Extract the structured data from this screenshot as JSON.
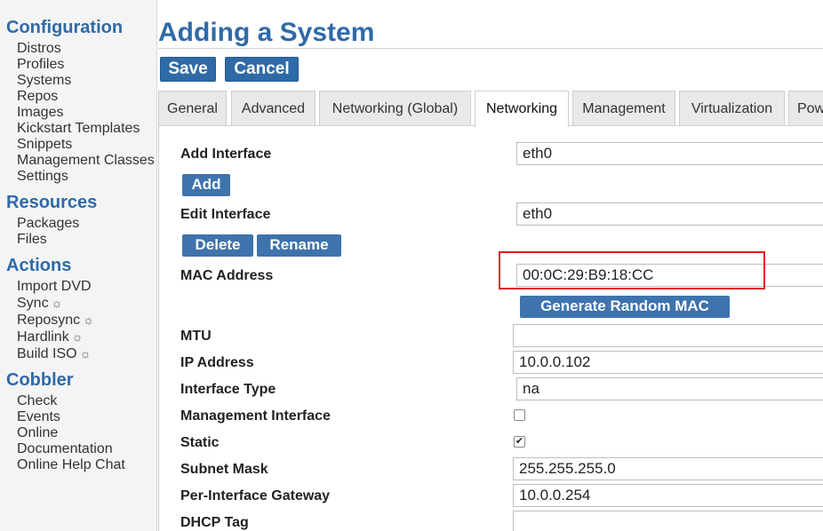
{
  "sidebar": {
    "sections": [
      {
        "heading": "Configuration",
        "items": [
          "Distros",
          "Profiles",
          "Systems",
          "Repos",
          "Images",
          "Kickstart Templates",
          "Snippets",
          "Management Classes",
          "Settings"
        ]
      },
      {
        "heading": "Resources",
        "items": [
          "Packages",
          "Files"
        ]
      },
      {
        "heading": "Actions",
        "items": [
          "Import DVD",
          "Sync",
          "Reposync",
          "Hardlink",
          "Build ISO"
        ]
      },
      {
        "heading": "Cobbler",
        "items": [
          "Check",
          "Events",
          "Online Documentation",
          "Online Help Chat"
        ]
      }
    ],
    "gear_glyph": "☼"
  },
  "header": {
    "title": "Adding a System"
  },
  "toolbar": {
    "save_label": "Save",
    "cancel_label": "Cancel"
  },
  "tabs": [
    "General",
    "Advanced",
    "Networking (Global)",
    "Networking",
    "Management",
    "Virtualization",
    "Pow"
  ],
  "active_tab": "Networking",
  "form": {
    "add_interface": {
      "label": "Add Interface",
      "value": "eth0",
      "button": "Add"
    },
    "edit_interface": {
      "label": "Edit Interface",
      "value": "eth0",
      "delete_button": "Delete",
      "rename_button": "Rename"
    },
    "mac_address": {
      "label": "MAC Address",
      "value": "00:0C:29:B9:18:CC",
      "generate_button": "Generate Random MAC"
    },
    "mtu": {
      "label": "MTU",
      "value": ""
    },
    "ip_address": {
      "label": "IP Address",
      "value": "10.0.0.102"
    },
    "interface_type": {
      "label": "Interface Type",
      "value": "na"
    },
    "management_interface": {
      "label": "Management Interface",
      "checked": false
    },
    "static": {
      "label": "Static",
      "checked": true
    },
    "subnet_mask": {
      "label": "Subnet Mask",
      "value": "255.255.255.0"
    },
    "gateway": {
      "label": "Per-Interface Gateway",
      "value": "10.0.0.254"
    },
    "dhcp_tag": {
      "label": "DHCP Tag",
      "value": ""
    }
  },
  "colors": {
    "accent": "#2f6aa8",
    "highlight": "#e31b1b"
  }
}
